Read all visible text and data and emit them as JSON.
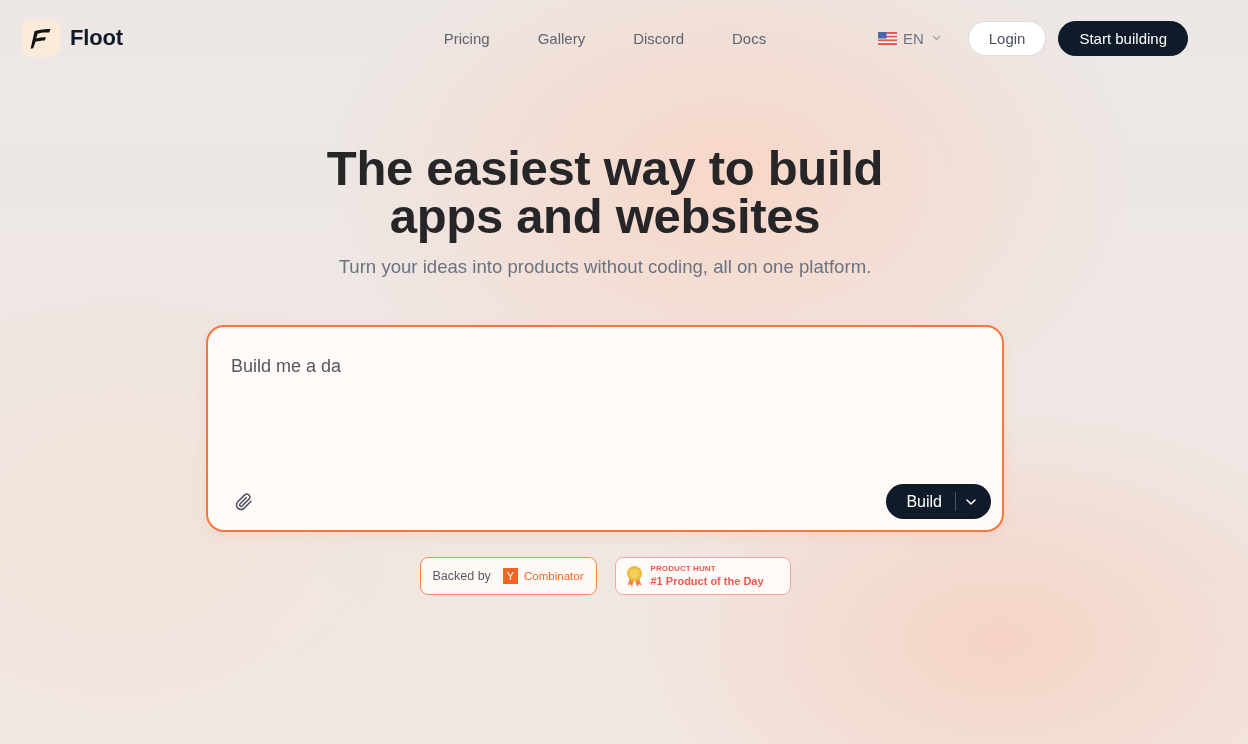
{
  "header": {
    "brand": "Floot",
    "nav": [
      "Pricing",
      "Gallery",
      "Discord",
      "Docs"
    ],
    "language": "EN",
    "buttons": [
      {
        "label": "Login",
        "kind": "secondary"
      },
      {
        "label": "Start building",
        "kind": "primary"
      }
    ]
  },
  "hero": {
    "title_lines": [
      "The easiest way to build",
      "apps and websites"
    ],
    "subtitle": "Turn your ideas into products without coding, all on one platform."
  },
  "prompt": {
    "value": "Build me a da",
    "submit": "Build"
  },
  "badges": [
    {
      "kind": "yc",
      "prefix": "Backed by",
      "mark": "Y",
      "name": "Combinator"
    },
    {
      "kind": "award",
      "eyebrow": "PRODUCT HUNT",
      "title": "#1 Product of the Day"
    }
  ]
}
